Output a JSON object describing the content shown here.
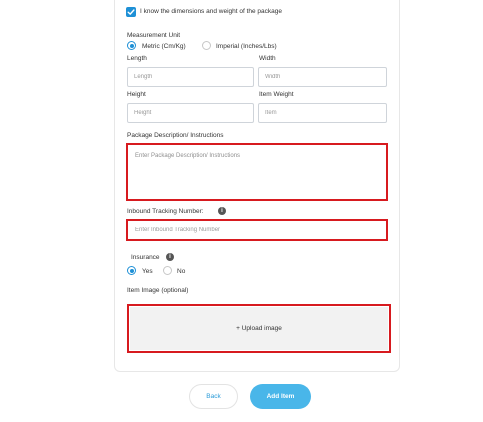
{
  "form": {
    "know_dimensions_label": "I know the dimensions and weight of the package",
    "know_dimensions_checked": true,
    "measurement_unit": {
      "label": "Measurement Unit",
      "options": [
        "Metric (Cm/Kg)",
        "Imperial (Inches/Lbs)"
      ],
      "selected": "Metric (Cm/Kg)"
    },
    "length": {
      "label": "Length",
      "placeholder": "Length"
    },
    "width": {
      "label": "Width",
      "placeholder": "Width"
    },
    "height": {
      "label": "Height",
      "placeholder": "Height"
    },
    "item_weight": {
      "label": "Item Weight",
      "placeholder": "Item"
    },
    "description": {
      "label": "Package Description/ Instructions",
      "placeholder": "Enter Package Description/ Instructions"
    },
    "tracking": {
      "label": "Inbound Tracking Number:",
      "placeholder": "Enter Inbound Tracking Number",
      "info_icon": "info-icon"
    },
    "insurance": {
      "label": "Insurance",
      "info_icon": "info-icon",
      "options": [
        "Yes",
        "No"
      ],
      "selected": "Yes"
    },
    "item_image": {
      "label": "Item Image (optional)",
      "upload_label": "+ Upload image"
    }
  },
  "actions": {
    "back_label": "Back",
    "add_label": "Add Item"
  },
  "colors": {
    "accent": "#1e90d6",
    "highlight": "#d71a1f",
    "add_button": "#49b6e9"
  }
}
